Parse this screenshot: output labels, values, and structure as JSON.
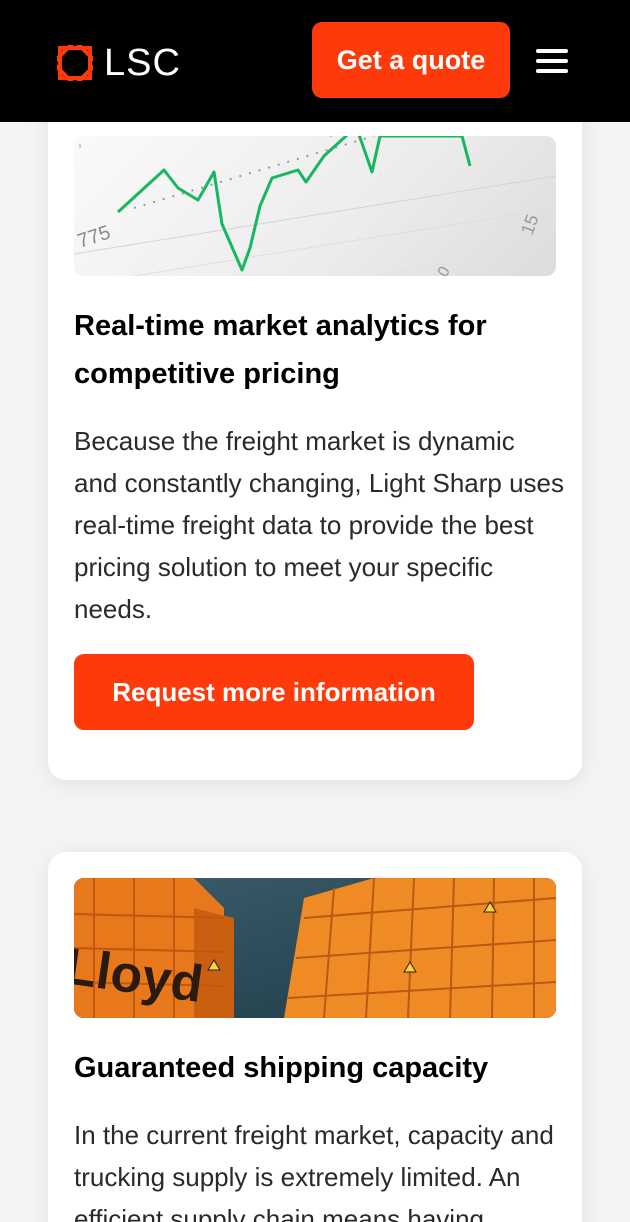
{
  "header": {
    "logo_text": "LSC",
    "quote_button_label": "Get a quote",
    "brand_color": "#ff3a0a",
    "background_color": "#000000"
  },
  "cards": [
    {
      "image_alt": "line chart illustration",
      "chart_tick_label": "775",
      "title": "Real-time market analytics for competitive pricing",
      "body": "Because the freight market is dynamic and constantly changing, Light Sharp uses real-time freight data to provide the best pricing solution to meet your specific needs.",
      "button_label": "Request more information"
    },
    {
      "image_alt": "orange shipping containers",
      "container_text": "Lloyd",
      "title": "Guaranteed shipping capacity",
      "body": "In the current freight market, capacity and trucking supply is extremely limited. An efficient supply chain means having"
    }
  ]
}
